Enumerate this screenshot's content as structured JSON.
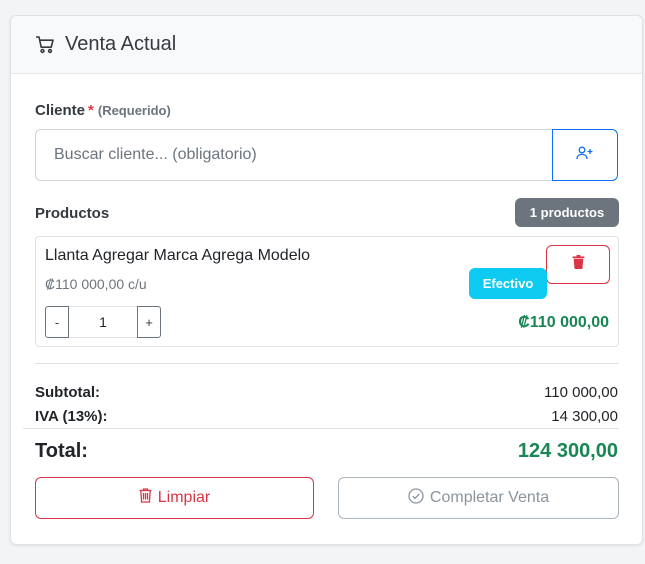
{
  "header": {
    "title": "Venta Actual",
    "icon": "shopping-cart-icon"
  },
  "client": {
    "label": "Cliente",
    "required_mark": "*",
    "required_text": "(Requerido)",
    "search_placeholder": "Buscar cliente... (obligatorio)",
    "search_value": "",
    "add_button_icon": "person-plus-icon"
  },
  "products": {
    "label": "Productos",
    "count_badge": "1 productos",
    "items": [
      {
        "name": "Llanta Agregar Marca Agrega Modelo",
        "unit_price": "₡110 000,00 c/u",
        "payment_badge": "Efectivo",
        "quantity": "1",
        "minus_label": "-",
        "plus_label": "+",
        "line_total": "₡110 000,00",
        "delete_icon": "trash-icon"
      }
    ]
  },
  "summary": {
    "subtotal_label": "Subtotal:",
    "subtotal_value": "110 000,00",
    "iva_label": "IVA (13%):",
    "iva_value": "14 300,00",
    "total_label": "Total:",
    "total_value": "124 300,00"
  },
  "actions": {
    "clear_label": "Limpiar",
    "complete_label": "Completar Venta"
  },
  "colors": {
    "danger": "#dc3545",
    "primary": "#0d6efd",
    "success": "#198754",
    "info": "#0dcaf0",
    "secondary": "#6c757d"
  }
}
